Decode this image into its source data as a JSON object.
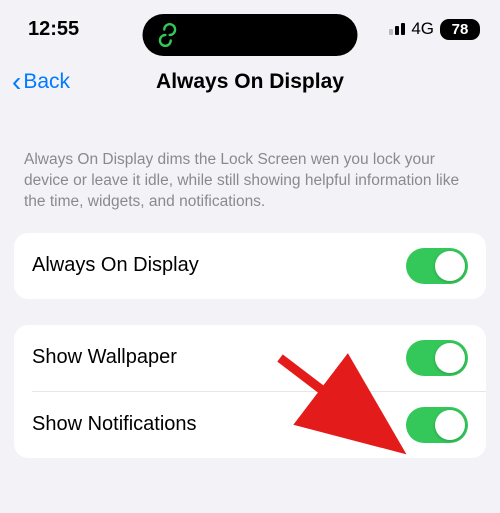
{
  "status_bar": {
    "time": "12:55",
    "network_label": "4G",
    "battery_percent": "78"
  },
  "nav": {
    "back_label": "Back",
    "title": "Always On Display"
  },
  "section": {
    "description": "Always On Display dims the Lock Screen wen you lock your device or leave it idle, while still showing helpful information like the time, widgets, and notifications."
  },
  "group1": {
    "row1_label": "Always On Display",
    "row1_on": true
  },
  "group2": {
    "row1_label": "Show Wallpaper",
    "row1_on": true,
    "row2_label": "Show Notifications",
    "row2_on": true
  }
}
